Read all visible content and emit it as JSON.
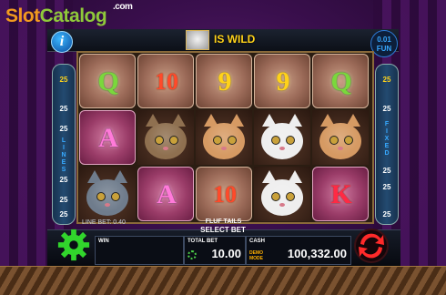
{
  "branding": {
    "slot": "Slot",
    "catalog": "Catalog",
    "com": ".com"
  },
  "header": {
    "info_glyph": "i",
    "wild_text": "IS WILD",
    "bet_value": "0.01",
    "currency": "FUN"
  },
  "paylines": {
    "left_numbers": [
      "25",
      "25",
      "25",
      "25",
      "25",
      "25",
      "25"
    ],
    "left_word": "LINES",
    "right_numbers": [
      "25",
      "25",
      "25",
      "25",
      "25",
      "25",
      "25"
    ],
    "right_word": "FIXED"
  },
  "reels": [
    [
      {
        "type": "letter",
        "text": "Q",
        "style": "q",
        "bg": "card"
      },
      {
        "type": "letter",
        "text": "A",
        "style": "a",
        "bg": "pinkcard"
      },
      {
        "type": "cat",
        "name": "grey-cat",
        "color": "#6f7c8c"
      }
    ],
    [
      {
        "type": "letter",
        "text": "10",
        "style": "ten",
        "bg": "card"
      },
      {
        "type": "cat",
        "name": "tabby-cat",
        "color": "#8f7050"
      },
      {
        "type": "letter",
        "text": "A",
        "style": "a",
        "bg": "pinkcard"
      }
    ],
    [
      {
        "type": "letter",
        "text": "9",
        "style": "nine",
        "bg": "card"
      },
      {
        "type": "cat",
        "name": "ginger-cat",
        "color": "#d69a63"
      },
      {
        "type": "letter",
        "text": "10",
        "style": "ten",
        "bg": "card"
      }
    ],
    [
      {
        "type": "letter",
        "text": "9",
        "style": "nine",
        "bg": "card"
      },
      {
        "type": "cat",
        "name": "white-cat",
        "color": "#eeeeee"
      },
      {
        "type": "cat",
        "name": "white-cat",
        "color": "#eeeeee"
      }
    ],
    [
      {
        "type": "letter",
        "text": "Q",
        "style": "q",
        "bg": "card"
      },
      {
        "type": "cat",
        "name": "ginger-cat",
        "color": "#d69a63"
      },
      {
        "type": "letter",
        "text": "K",
        "style": "k",
        "bg": "pinkcard"
      }
    ]
  ],
  "status": {
    "line_bet": "LINE BET: 0.40",
    "fluf_tails": "FLUF TAILS"
  },
  "controls": {
    "select_bet": "SELECT BET",
    "win_label": "WIN",
    "win_value": "",
    "total_bet_label": "TOTAL BET",
    "total_bet_value": "10.00",
    "cash_label": "CASH",
    "cash_value": "100,332.00",
    "demo_mode": "DEMO MODE"
  },
  "colors": {
    "accent_yellow": "#ffd31a",
    "accent_blue": "#37a9ff",
    "brand_green": "#8fc93a",
    "brand_orange": "#f29a1f"
  }
}
